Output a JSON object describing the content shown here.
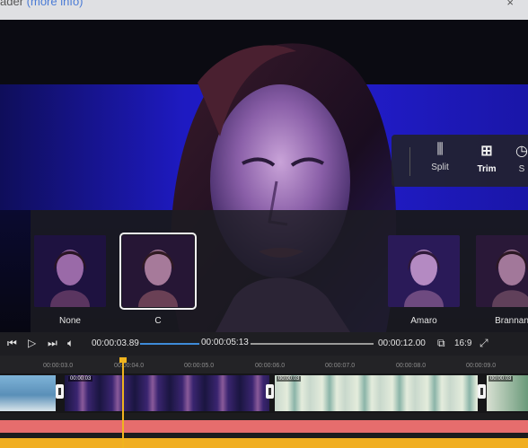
{
  "header": {
    "text": "ader",
    "link": "(more info)",
    "close": "×"
  },
  "editor": {
    "tools": [
      {
        "label": "Split",
        "icon": "split-icon"
      },
      {
        "label": "Trim",
        "icon": "trim-icon"
      },
      {
        "label": "S",
        "icon": "speed-icon"
      }
    ],
    "active_tool": "Trim"
  },
  "filters": {
    "items": [
      {
        "label": "None"
      },
      {
        "label": "C"
      },
      {
        "label": "Amaro"
      },
      {
        "label": "Brannan"
      }
    ],
    "selected": 1
  },
  "playback": {
    "current_time": "00:00:03.89",
    "scrub_time": "00:00:05:13",
    "total_time": "00:00:12.00",
    "aspect_ratio": "16:9",
    "progress": 0.35
  },
  "timeline": {
    "ticks": [
      "00:00:03.0",
      "00:00:04.0",
      "00:00:05.0",
      "00:00:06.0",
      "00:00:07.0",
      "00:00:08.0",
      "00:00:09.0"
    ],
    "clip_tags": [
      "00:00:03",
      "00:00:03",
      "00:00:03"
    ]
  },
  "colors": {
    "accent": "#3e8bd9",
    "playhead": "#f0b41e",
    "audio_track": "#e66d6d",
    "music_track": "#f0ae22"
  }
}
